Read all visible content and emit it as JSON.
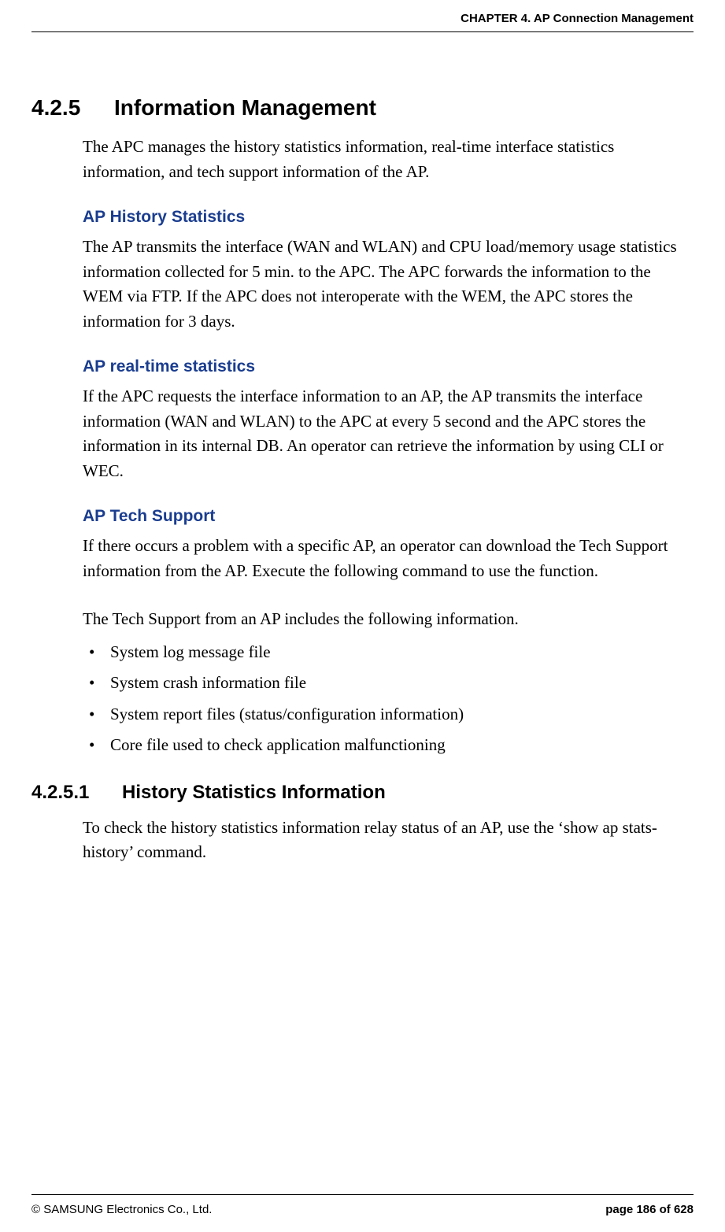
{
  "header": {
    "chapter": "CHAPTER 4. AP Connection Management"
  },
  "section_main": {
    "number": "4.2.5",
    "title": "Information Management",
    "intro": "The APC manages the history statistics information, real-time interface statistics information, and tech support information of the AP."
  },
  "sub1": {
    "title": "AP History Statistics",
    "text": "The AP transmits the interface (WAN and WLAN) and CPU load/memory usage statistics information collected for 5 min. to the APC. The APC forwards the information to the WEM via FTP. If the APC does not interoperate with the WEM, the APC stores the information for 3 days."
  },
  "sub2": {
    "title": "AP real-time statistics",
    "text": "If the APC requests the interface information to an AP, the AP transmits the interface information (WAN and WLAN) to the APC at every 5 second and the APC stores the information in its internal DB. An operator can retrieve the information by using CLI or WEC."
  },
  "sub3": {
    "title": "AP Tech Support",
    "text1": "If there occurs a problem with a specific AP, an operator can download the Tech Support information from the AP. Execute the following command to use the function.",
    "text2": "The Tech Support from an AP includes the following information.",
    "bullets": {
      "b0": "System log message file",
      "b1": "System crash information file",
      "b2": "System report files (status/configuration information)",
      "b3": "Core file used to check application malfunctioning"
    }
  },
  "section_sub": {
    "number": "4.2.5.1",
    "title": "History Statistics Information",
    "text": "To check the history statistics information relay status of an AP, use the ‘show ap stats-history’ command."
  },
  "footer": {
    "copyright": "© SAMSUNG Electronics Co., Ltd.",
    "page": "page 186 of 628"
  }
}
